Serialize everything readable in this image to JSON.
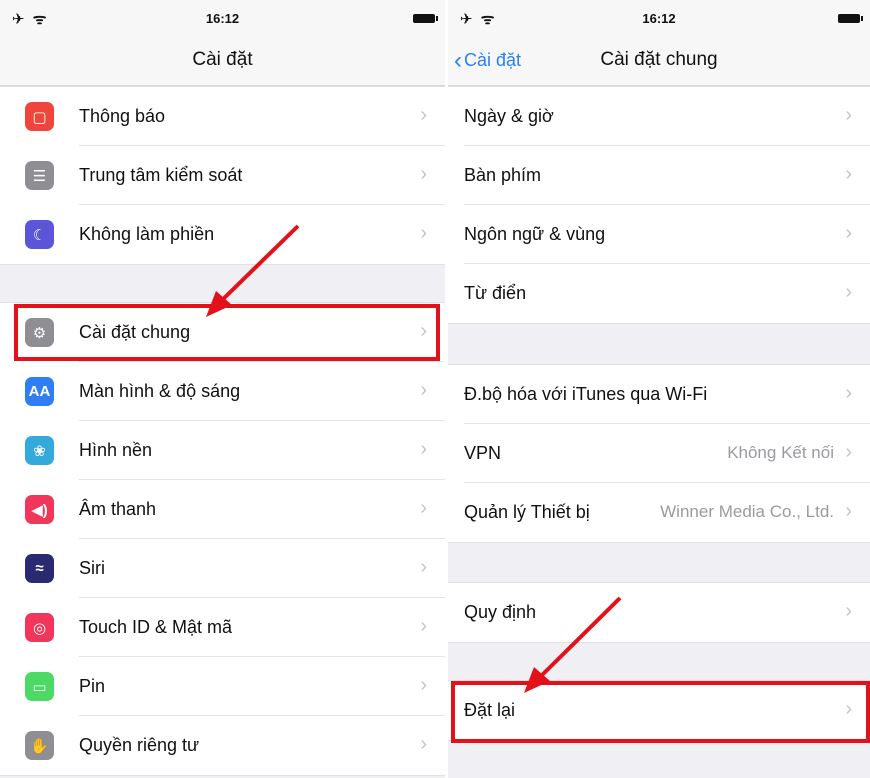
{
  "left": {
    "status": {
      "signal": "✈ ᯤ",
      "time": "16:12"
    },
    "title": "Cài đặt",
    "groups": [
      [
        {
          "label": "Thông báo",
          "icon": "notifications-icon",
          "color": "#f0453a"
        },
        {
          "label": "Trung tâm kiểm soát",
          "icon": "control-center-icon",
          "color": "#8e8e93"
        },
        {
          "label": "Không làm phiền",
          "icon": "moon-icon",
          "color": "#5b55d8"
        }
      ],
      [
        {
          "label": "Cài đặt chung",
          "icon": "gear-icon",
          "color": "#8e8e93"
        },
        {
          "label": "Màn hình & độ sáng",
          "icon": "display-brightness-icon",
          "color": "#2f7ef5"
        },
        {
          "label": "Hình nền",
          "icon": "wallpaper-icon",
          "color": "#34aadc"
        },
        {
          "label": "Âm thanh",
          "icon": "speaker-icon",
          "color": "#f0365a"
        },
        {
          "label": "Siri",
          "icon": "siri-icon",
          "color": "#2a2a72"
        },
        {
          "label": "Touch ID & Mật mã",
          "icon": "fingerprint-icon",
          "color": "#f0365a"
        },
        {
          "label": "Pin",
          "icon": "battery-icon",
          "color": "#4cd964"
        },
        {
          "label": "Quyền riêng tư",
          "icon": "hand-icon",
          "color": "#8e8e93"
        }
      ]
    ]
  },
  "right": {
    "status": {
      "signal": "✈ ᯤ",
      "time": "16:12"
    },
    "back_label": "Cài đặt",
    "title": "Cài đặt chung",
    "groups": [
      [
        {
          "label": "Ngày & giờ"
        },
        {
          "label": "Bàn phím"
        },
        {
          "label": "Ngôn ngữ & vùng"
        },
        {
          "label": "Từ điển"
        }
      ],
      [
        {
          "label": "Đ.bộ hóa với iTunes qua Wi-Fi"
        },
        {
          "label": "VPN",
          "value": "Không Kết nối"
        },
        {
          "label": "Quản lý Thiết bị",
          "value": "Winner Media Co., Ltd."
        }
      ],
      [
        {
          "label": "Quy định"
        }
      ],
      [
        {
          "label": "Đặt lại"
        }
      ]
    ]
  },
  "icon_glyphs": {
    "notifications-icon": "▢",
    "control-center-icon": "☰",
    "moon-icon": "☾",
    "gear-icon": "⚙",
    "display-brightness-icon": "AA",
    "wallpaper-icon": "❀",
    "speaker-icon": "◀)",
    "siri-icon": "≈",
    "fingerprint-icon": "◎",
    "battery-icon": "▭",
    "hand-icon": "✋"
  },
  "colors": {
    "highlight": "#e3121a",
    "ios_blue": "#2a7ff8"
  }
}
